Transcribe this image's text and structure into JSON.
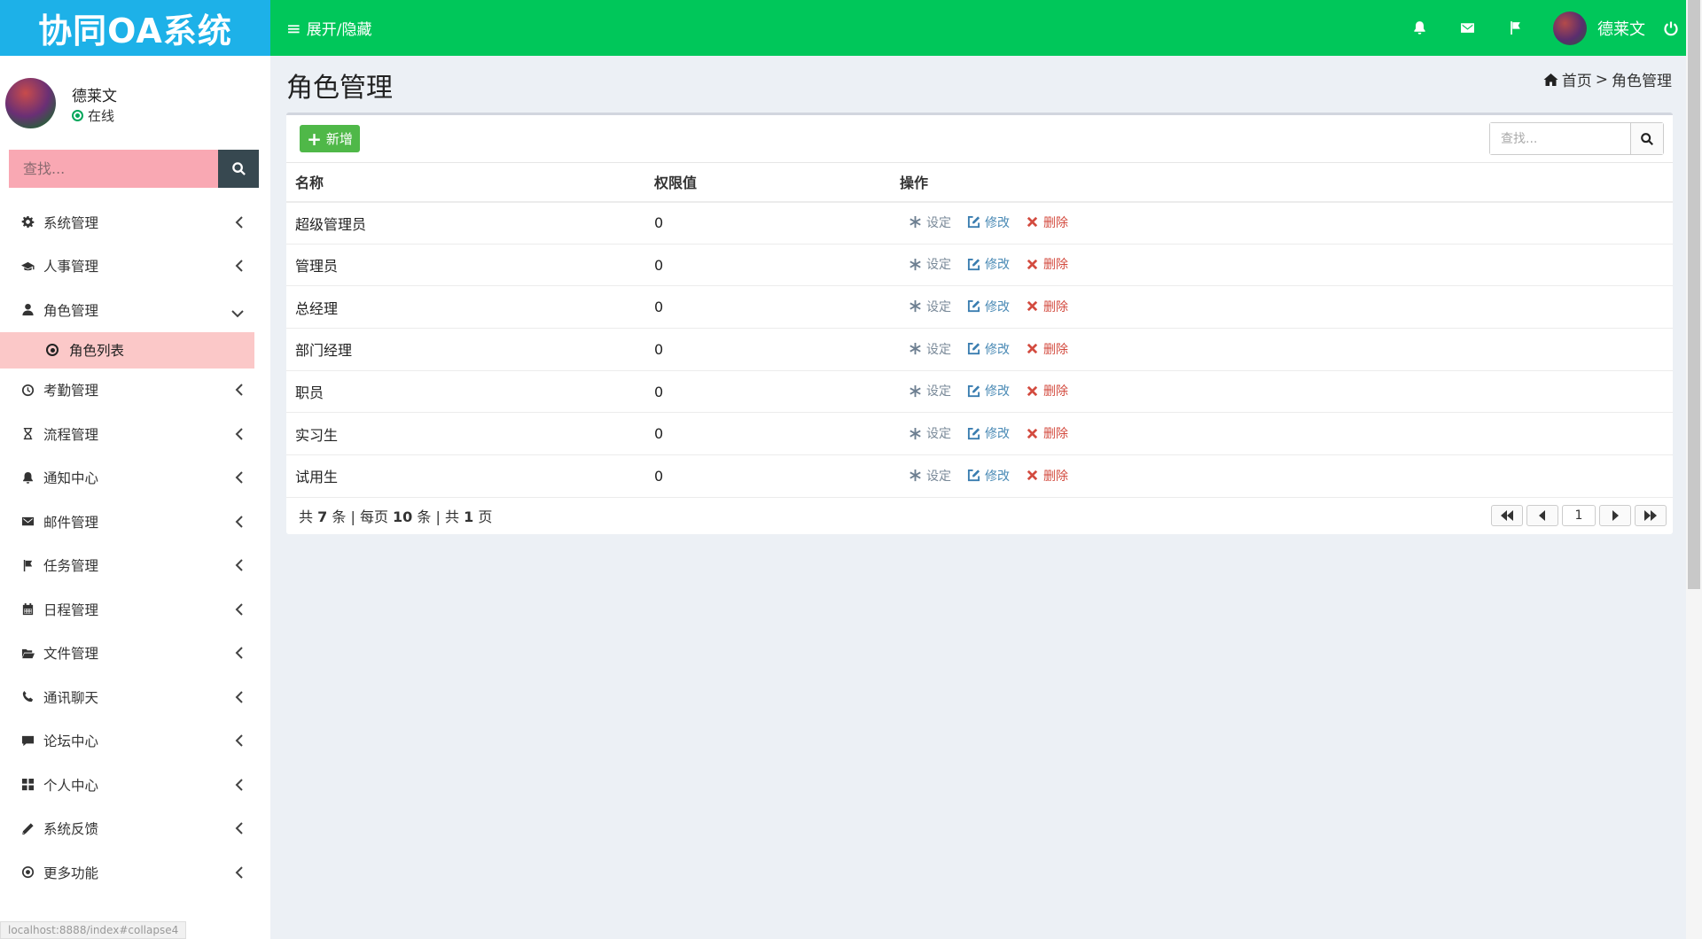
{
  "brand": {
    "title": "协同OA系统"
  },
  "topbar": {
    "toggle_label": "展开/隐藏",
    "user_name": "德莱文",
    "icons": [
      "bell-icon",
      "envelope-icon",
      "flag-icon",
      "power-icon"
    ]
  },
  "user_panel": {
    "name": "德莱文",
    "status": "在线"
  },
  "side_search": {
    "placeholder": "查找..."
  },
  "sidebar": {
    "items": [
      {
        "label": "系统管理",
        "icon": "gear-icon"
      },
      {
        "label": "人事管理",
        "icon": "graduation-cap-icon"
      },
      {
        "label": "角色管理",
        "icon": "user-icon",
        "expanded": true,
        "children": [
          {
            "label": "角色列表",
            "icon": "dot-circle-icon"
          }
        ]
      },
      {
        "label": "考勤管理",
        "icon": "clock-icon"
      },
      {
        "label": "流程管理",
        "icon": "hourglass-icon"
      },
      {
        "label": "通知中心",
        "icon": "bell-icon"
      },
      {
        "label": "邮件管理",
        "icon": "envelope-icon"
      },
      {
        "label": "任务管理",
        "icon": "flag-icon"
      },
      {
        "label": "日程管理",
        "icon": "calendar-icon"
      },
      {
        "label": "文件管理",
        "icon": "folder-open-icon"
      },
      {
        "label": "通讯聊天",
        "icon": "phone-icon"
      },
      {
        "label": "论坛中心",
        "icon": "comment-icon"
      },
      {
        "label": "个人中心",
        "icon": "grid-icon"
      },
      {
        "label": "系统反馈",
        "icon": "pencil-icon"
      },
      {
        "label": "更多功能",
        "icon": "dot-circle-icon"
      }
    ]
  },
  "statusbar": {
    "url": "localhost:8888/index#collapse4"
  },
  "page": {
    "title": "角色管理",
    "breadcrumb": {
      "home": "首页",
      "separator": ">",
      "current": "角色管理"
    }
  },
  "toolbar": {
    "add_label": "新增",
    "search_placeholder": "查找..."
  },
  "table": {
    "columns": [
      "名称",
      "权限值",
      "操作"
    ],
    "actions": {
      "set": "设定",
      "edit": "修改",
      "delete": "删除"
    },
    "rows": [
      {
        "name": "超级管理员",
        "value": "0"
      },
      {
        "name": "管理员",
        "value": "0"
      },
      {
        "name": "总经理",
        "value": "0"
      },
      {
        "name": "部门经理",
        "value": "0"
      },
      {
        "name": "职员",
        "value": "0"
      },
      {
        "name": "实习生",
        "value": "0"
      },
      {
        "name": "试用生",
        "value": "0"
      }
    ]
  },
  "pagination": {
    "prefix": "共",
    "total": "7",
    "unit": "条",
    "sep1": "|",
    "per_page_label": "每页",
    "per_page": "10",
    "unit2": "条",
    "sep2": "|",
    "pages_prefix": "共",
    "pages": "1",
    "pages_unit": "页",
    "current_page": "1"
  },
  "colors": {
    "header": "#00c75a",
    "logo": "#1db1e8",
    "add_button": "#4fb848",
    "active_sub": "#fbc8c8",
    "search_bg": "#f9a8b3"
  }
}
